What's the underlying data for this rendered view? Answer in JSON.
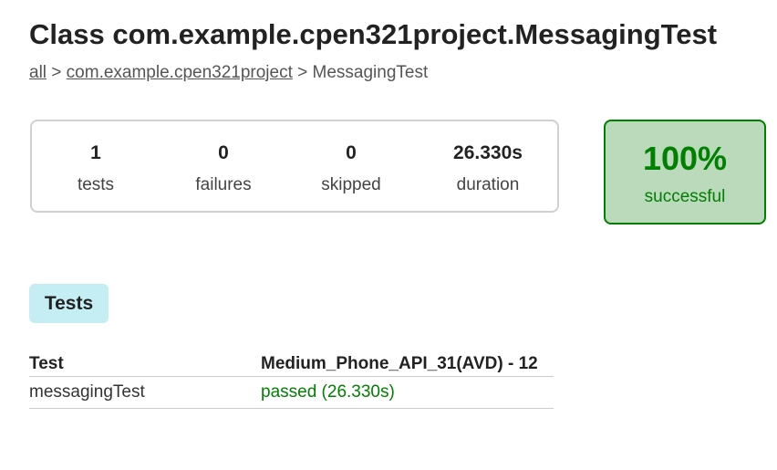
{
  "header": {
    "title": "Class com.example.cpen321project.MessagingTest"
  },
  "breadcrumb": {
    "root_link": "all",
    "sep1": " > ",
    "package_link": "com.example.cpen321project",
    "sep2": " > ",
    "current": "MessagingTest"
  },
  "summary": {
    "tests": {
      "value": "1",
      "label": "tests"
    },
    "failures": {
      "value": "0",
      "label": "failures"
    },
    "skipped": {
      "value": "0",
      "label": "skipped"
    },
    "duration": {
      "value": "26.330s",
      "label": "duration"
    }
  },
  "success_rate": {
    "value": "100%",
    "label": "successful",
    "color": "#008000",
    "background": "#bbd9bb"
  },
  "tabs": [
    {
      "label": "Tests",
      "selected": true
    }
  ],
  "results_table": {
    "columns": [
      "Test",
      "Medium_Phone_API_31(AVD) - 12"
    ],
    "rows": [
      {
        "test": "messagingTest",
        "result": "passed (26.330s)",
        "status_color": "#008000"
      }
    ]
  },
  "colors": {
    "tab_background": "#c5eef4",
    "passed": "#008000"
  }
}
